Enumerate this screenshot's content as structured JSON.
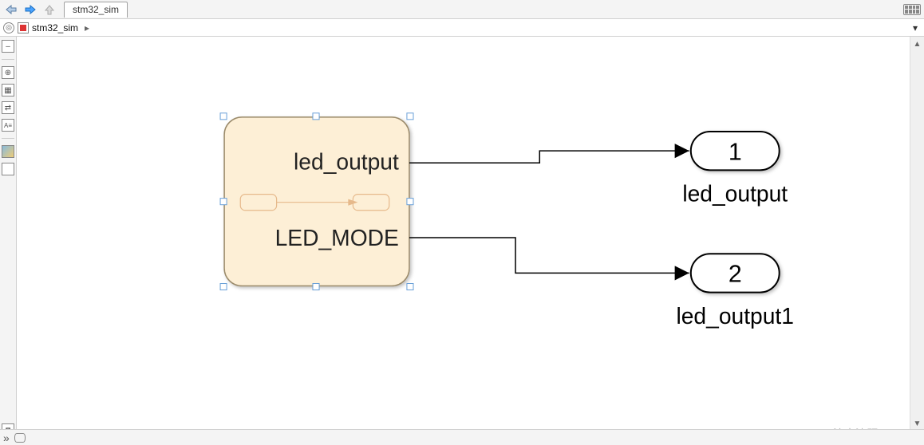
{
  "tabs": {
    "active": "stm32_sim"
  },
  "breadcrumb": {
    "root": "stm32_sim"
  },
  "block": {
    "port1_label": "led_output",
    "port2_label": "LED_MODE"
  },
  "outports": [
    {
      "num": "1",
      "label": "led_output"
    },
    {
      "num": "2",
      "label": "led_output1"
    }
  ],
  "watermark": "CSDN @注意沈题，！",
  "icons": {
    "back": "back-arrow-icon",
    "fwd": "forward-arrow-icon",
    "up": "up-arrow-icon"
  }
}
